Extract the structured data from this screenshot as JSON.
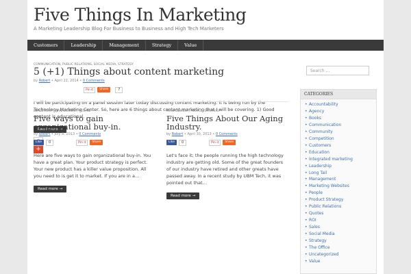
{
  "site": {
    "title": "Five Things In Marketing",
    "tagline": "A Marketing Leadership Blog For Business to Business and High Tech Marketers"
  },
  "nav": [
    {
      "label": "Customers"
    },
    {
      "label": "Leadership"
    },
    {
      "label": "Management"
    },
    {
      "label": "Strategy"
    },
    {
      "label": "Value"
    }
  ],
  "featured": {
    "categories": "COMMUNICATION, PUBLIC RELATIONS, SOCIAL MEDIA, STRATEGY",
    "title": "5 (+1) Things about content marketing",
    "by": "by",
    "author": "Robert",
    "date": "April 22, 2014",
    "comments": "0 Comments",
    "pin_label": "Pin it",
    "share_label": "Share",
    "share_count": "7",
    "excerpt": "I will be participating on a panel session later today discussing content marketing. It is being run by the Technology Marketing Center. So, here are 6 things about content marketing that I will be covering. 1)      Good content is educational.  …",
    "read_more": "Read more →",
    "vote_count": "7",
    "vote_plus": "+"
  },
  "posts": [
    {
      "categories": "LEADERSHIP, MANAGEMENT, PEOPLE",
      "title": "Five ways to gain organizational buy-in.",
      "by": "by",
      "author": "Robert",
      "date": "July 8, 2013",
      "comments": "0 Comments",
      "like_label": "Like",
      "like_count": "0",
      "pin_label": "Pin it",
      "share_label": "Share",
      "excerpt": "Here are five ways to gain organizational buy-in. You have a great plan. Your product strategy is perfect. Your new product has a killer value proposition. All you need to is get it to market. If you are in a…",
      "read_more": "Read more →"
    },
    {
      "categories": "MANAGEMENT, PEOPLE, STRATEGY",
      "title": "Five Things About Our Aging Industry.",
      "by": "by",
      "author": "Robert",
      "date": "April 30, 2013",
      "comments": "0 Comments",
      "like_label": "Like",
      "like_count": "0",
      "pin_label": "Pin it",
      "share_label": "Share",
      "excerpt": "Let's face it; the people running the high technology industry are getting old. Some of the great founders of our industry have retired and other greats have passed away. In a recent study by UBM Tech, it was pointed out that…",
      "read_more": "Read more →"
    }
  ],
  "sidebar": {
    "search_placeholder": "Search …",
    "categories_title": "CATEGORIES",
    "categories": [
      {
        "label": "Accountability"
      },
      {
        "label": "Agency"
      },
      {
        "label": "Books"
      },
      {
        "label": "Communication"
      },
      {
        "label": "Community"
      },
      {
        "label": "Competition"
      },
      {
        "label": "Customers"
      },
      {
        "label": "Education"
      },
      {
        "label": "Integrated marketing"
      },
      {
        "label": "Leadership"
      },
      {
        "label": "Long Tail"
      },
      {
        "label": "Management"
      },
      {
        "label": "Marketing Websites"
      },
      {
        "label": "People"
      },
      {
        "label": "Product Strategy"
      },
      {
        "label": "Public Relations"
      },
      {
        "label": "Quotes"
      },
      {
        "label": "ROI"
      },
      {
        "label": "Sales"
      },
      {
        "label": "Social Media"
      },
      {
        "label": "Strategy"
      },
      {
        "label": "The Office"
      },
      {
        "label": "Uncategorized"
      },
      {
        "label": "Value"
      }
    ]
  },
  "colors": {
    "nav_bg": "#3a3a3a",
    "link": "#3a6fb0",
    "share_orange": "#f26522",
    "facebook": "#3b5998",
    "vote_red": "#e0492b"
  }
}
